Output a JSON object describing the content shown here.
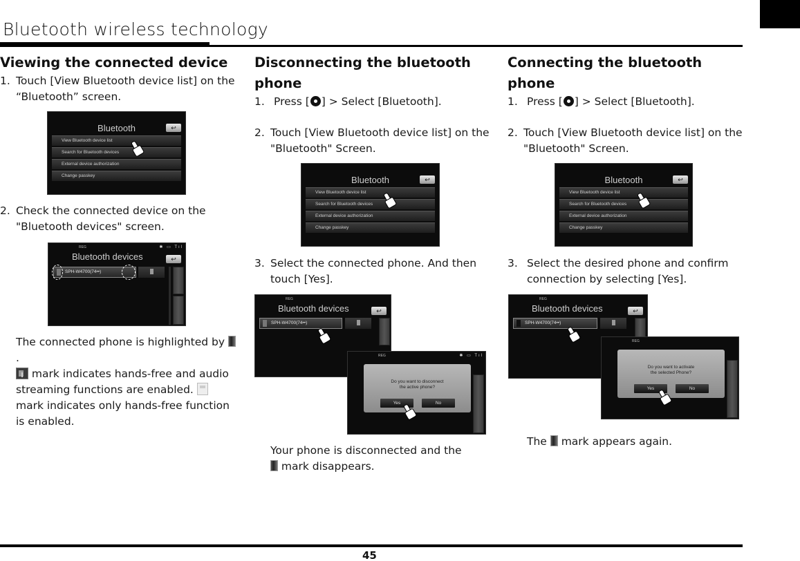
{
  "header": {
    "title": "Bluetooth wireless technology"
  },
  "footer": {
    "page_number": "45"
  },
  "sections": [
    {
      "title": "Viewing the connected device",
      "steps": [
        {
          "num": "1.",
          "text_a": "Touch [View Bluetooth device list] on the “Bluetooth” screen."
        },
        {
          "num": "2.",
          "text_a": "Check the connected device on the \"Bluetooth devices\" screen."
        }
      ],
      "note": {
        "line1_a": "The connected phone is highlighted by ",
        "line1_b": ".",
        "line2": " mark indicates hands-free and audio streaming functions are enabled. ",
        "line3": " mark indicates only hands-free function is enabled."
      }
    },
    {
      "title": "Disconnecting the bluetooth phone",
      "steps": [
        {
          "num": "1.",
          "text_a": "Press [",
          "text_b": "] > Select [Bluetooth]."
        },
        {
          "num": "2.",
          "text_a": "Touch [View Bluetooth device list] on the \"Bluetooth\" Screen."
        },
        {
          "num": "3.",
          "text_a": "Select the connected phone. And then touch [Yes]."
        }
      ],
      "note": {
        "line1": "Your phone is disconnected and the",
        "line2": " mark disappears."
      }
    },
    {
      "title": "Connecting the bluetooth phone",
      "steps": [
        {
          "num": "1.",
          "text_a": "Press [",
          "text_b": "] > Select [Bluetooth]."
        },
        {
          "num": "2.",
          "text_a": "Touch [View Bluetooth device list] on the \"Bluetooth\" Screen."
        },
        {
          "num": "3.",
          "text_a": "Select the desired phone and confirm connection by selecting [Yes]."
        }
      ],
      "note": {
        "line1_a": "The ",
        "line1_b": " mark appears again."
      }
    }
  ],
  "screens": {
    "bluetooth_menu": {
      "title": "Bluetooth",
      "back_icon": "↩",
      "items": [
        "View Bluetooth device list",
        "Search for Bluetooth devices",
        "External device authorization",
        "Change passkey"
      ]
    },
    "bluetooth_devices": {
      "title": "Bluetooth devices",
      "reg": "REG",
      "status": "✱ ▭ Tıl",
      "back_icon": "↩",
      "device": "SPH-W4700(74••)"
    },
    "disconnect_dialog": {
      "reg": "REG",
      "status": "✱ ▭ Tıl",
      "message_1": "Do you want to disconnect",
      "message_2": "the active phone?",
      "yes": "Yes",
      "no": "No"
    },
    "connect_dialog": {
      "reg": "REG",
      "message_1": "Do you want to activate",
      "message_2": "the selected Phone?",
      "yes": "Yes",
      "no": "No"
    }
  }
}
